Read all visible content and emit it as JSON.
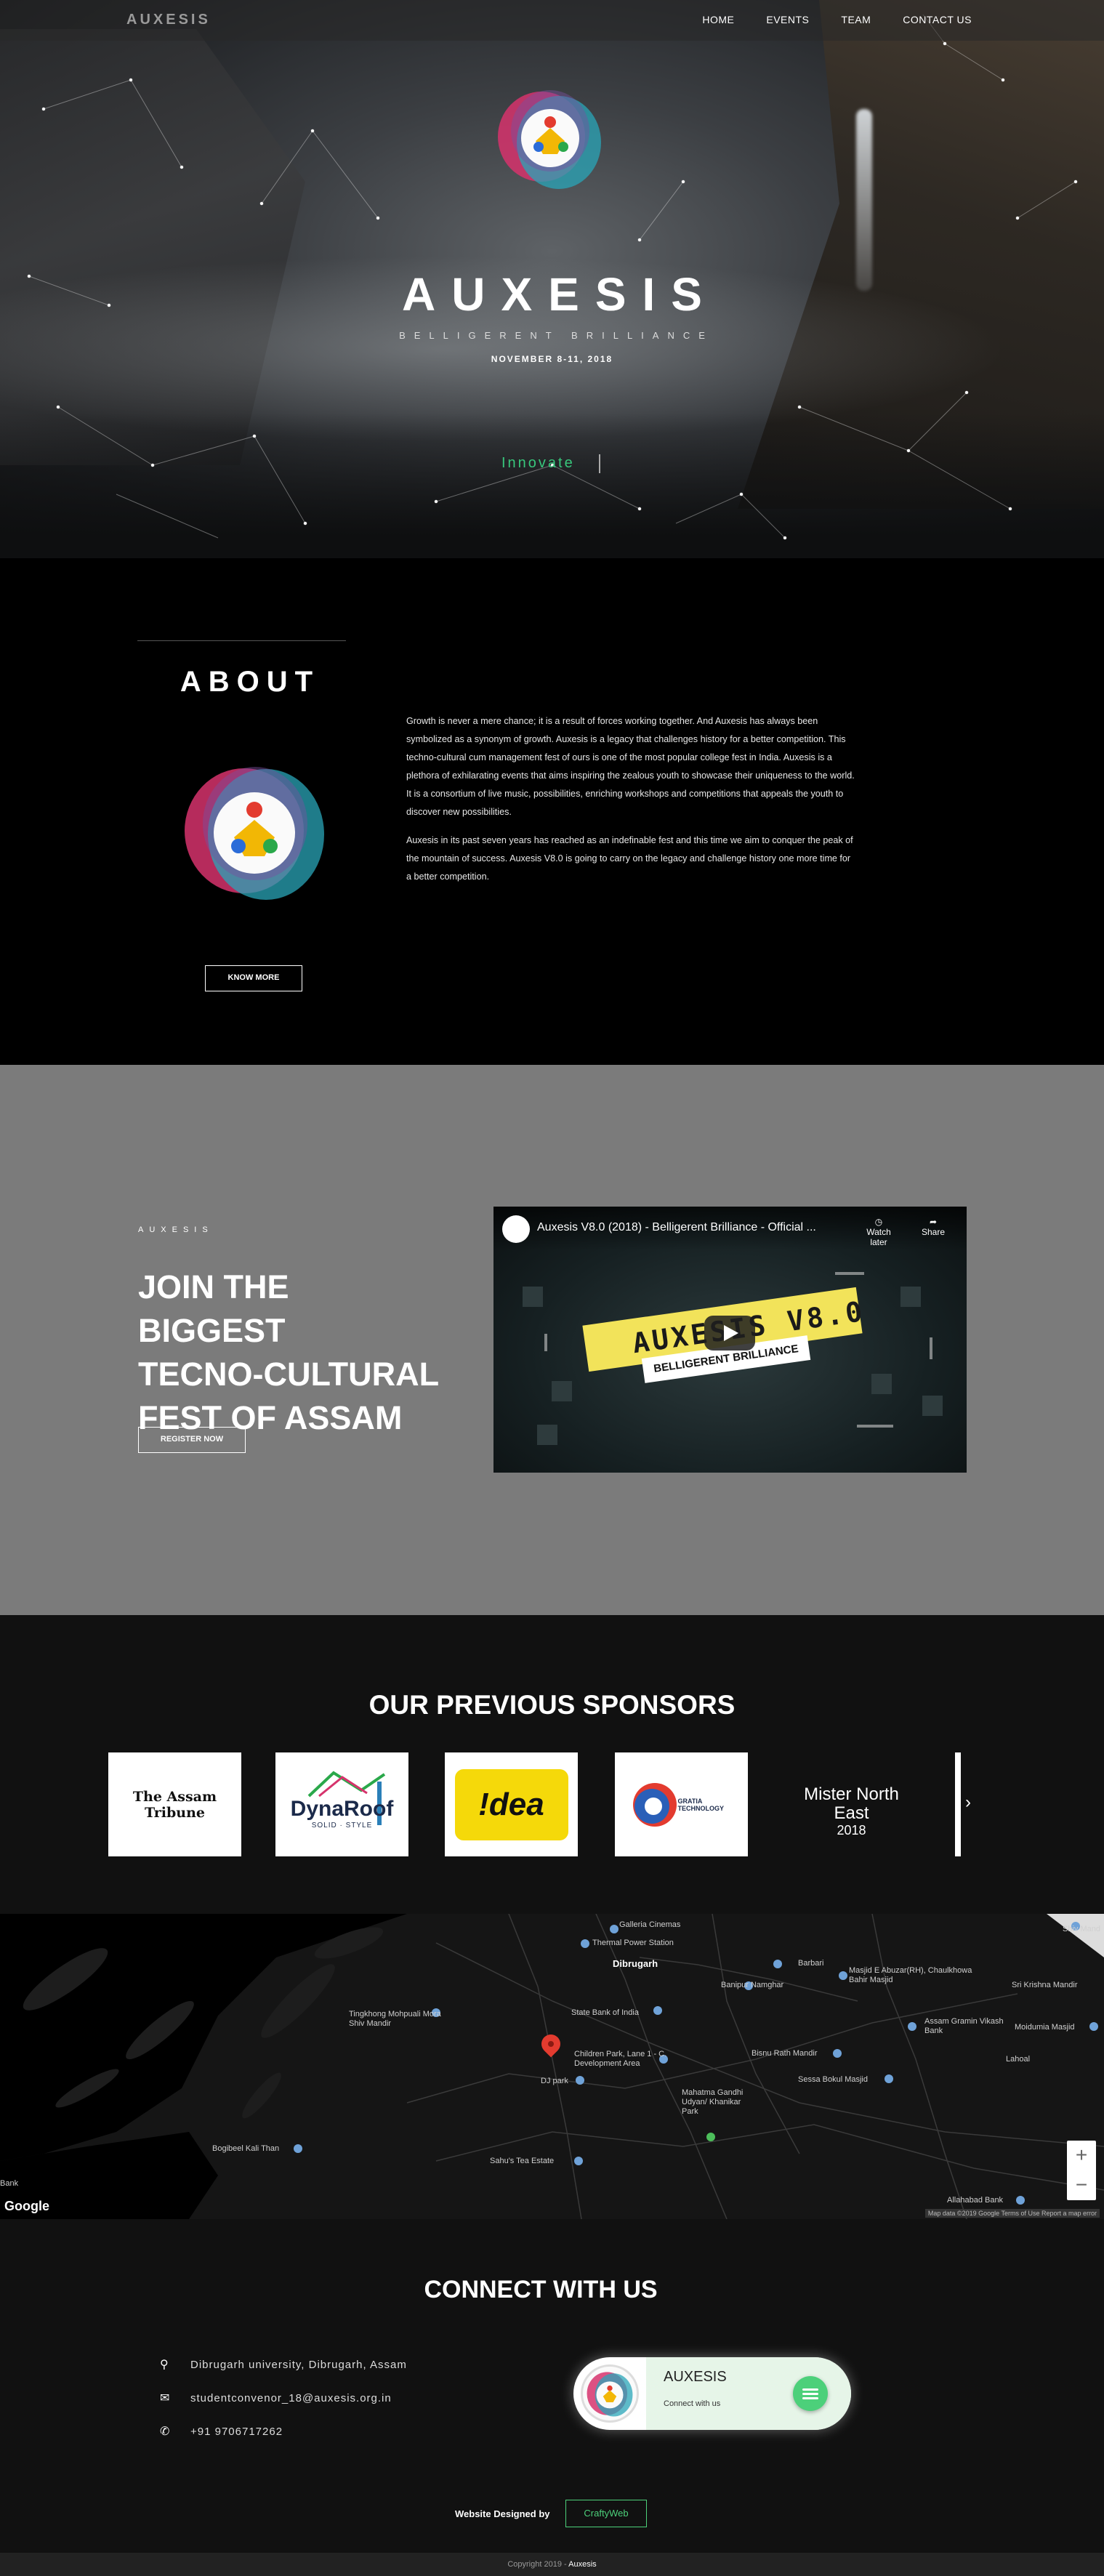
{
  "nav": {
    "brand": "AUXESIS",
    "items": [
      "HOME",
      "EVENTS",
      "TEAM",
      "CONTACT US"
    ]
  },
  "hero": {
    "title": "AUXESIS",
    "tagline": "BELLIGERENT BRILLIANCE",
    "date": "NOVEMBER 8-11, 2018",
    "typed_word": "Innovate"
  },
  "about": {
    "heading": "ABOUT",
    "button": "KNOW MORE",
    "paragraphs": [
      "Growth is never a mere chance; it is a result of forces working together. And Auxesis has always been symbolized as a synonym of growth. Auxesis is a legacy that challenges history for a better competition. This techno-cultural cum management fest of ours is one of the most popular college fest in India. Auxesis is a plethora of exhilarating events that aims inspiring the zealous youth to showcase their uniqueness to the world. It is a consortium of live music, possibilities, enriching workshops and competitions that appeals the youth to discover new possibilities.",
      "Auxesis in its past seven years has reached as an indefinable fest and this time we aim to conquer the peak of the mountain of success. Auxesis V8.0 is going to carry on the legacy and challenge history one more time for a better competition."
    ]
  },
  "join": {
    "kicker": "AUXESIS",
    "heading_lines": [
      "JOIN THE BIGGEST",
      "TECNO-CULTURAL",
      "FEST OF ASSAM"
    ],
    "button": "REGISTER NOW",
    "video": {
      "title": "Auxesis V8.0 (2018) - Belligerent Brilliance - Official ...",
      "watch_later": "Watch later",
      "share": "Share",
      "banner": "AUXESIS V8.0",
      "subbanner": "BELLIGERENT BRILLIANCE"
    }
  },
  "sponsors": {
    "heading": "OUR PREVIOUS SPONSORS",
    "logos": [
      "The Assam Tribune",
      "DynaRoof",
      "SOLID · STYLE",
      "!dea",
      "GRATIA TECHNOLOGY",
      "Mister North East",
      "2018"
    ]
  },
  "map": {
    "labels": [
      {
        "t": "Galleria Cinemas",
        "b": false
      },
      {
        "t": "Thermal Power Station",
        "b": false
      },
      {
        "t": "Dibrugarh",
        "b": true
      },
      {
        "t": "Barbari",
        "b": false
      },
      {
        "t": "Masjid E Abuzar(RH), Chaulkhowa Bahir Masjid",
        "b": false
      },
      {
        "t": "Sri Krishna Mandir",
        "b": false
      },
      {
        "t": "Banipur Namghar",
        "b": false
      },
      {
        "t": "Tingkhong Mohpuali Mora Shiv Mandir",
        "b": false
      },
      {
        "t": "State Bank of India",
        "b": false
      },
      {
        "t": "Assam Gramin Vikash Bank",
        "b": false
      },
      {
        "t": "Moidumia Masjid",
        "b": false
      },
      {
        "t": "Children Park, Lane 1 - C. Development Area",
        "b": false
      },
      {
        "t": "Bisnu Rath Mandir",
        "b": false
      },
      {
        "t": "Lahoal",
        "b": false
      },
      {
        "t": "DJ park",
        "b": false
      },
      {
        "t": "Sessa Bokul Masjid",
        "b": false
      },
      {
        "t": "Mahatma Gandhi Udyan/ Khanikar Park",
        "b": false
      },
      {
        "t": "Bogibeel Kali Than",
        "b": false
      },
      {
        "t": "Sahu's Tea Estate",
        "b": false
      },
      {
        "t": "Allahabad Bank",
        "b": false
      },
      {
        "t": "Shiv Mand",
        "b": false
      },
      {
        "t": "Bank",
        "b": false
      }
    ],
    "google": "Google",
    "credits": "Map data ©2019 Google  Terms of Use  Report a map error"
  },
  "connect": {
    "heading": "CONNECT WITH US",
    "address": "Dibrugarh university, Dibrugarh, Assam",
    "email": "studentconvenor_18@auxesis.org.in",
    "phone": "+91 9706717262",
    "card_name": "AUXESIS",
    "card_sub": "Connect with us",
    "designed_by": "Website Designed by",
    "designer": "CraftyWeb"
  },
  "footer": {
    "copyright": "Copyright 2019 - ",
    "brand": "Auxesis"
  },
  "colors": {
    "accent_green": "#38c77c",
    "join_bg": "#7b7b7b",
    "dark_bg": "#111111"
  }
}
